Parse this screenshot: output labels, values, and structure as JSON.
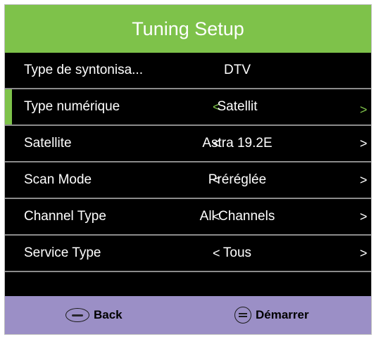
{
  "header": {
    "title": "Tuning Setup"
  },
  "rows": [
    {
      "label": "Type de syntonisa...",
      "value": "DTV",
      "has_arrows": false
    },
    {
      "label": "Type numérique",
      "value": "Satellit",
      "has_arrows": true,
      "left_arrow": "<",
      "right_arrow": ">"
    },
    {
      "label": "Satellite",
      "value": "Astra 19.2E",
      "has_arrows": true,
      "left_arrow": "<",
      "right_arrow": ">"
    },
    {
      "label": "Scan Mode",
      "value": "Préréglée",
      "has_arrows": true,
      "left_arrow": "<",
      "right_arrow": ">"
    },
    {
      "label": "Channel Type",
      "value": "All Channels",
      "has_arrows": true,
      "left_arrow": "<",
      "right_arrow": ">"
    },
    {
      "label": "Service Type",
      "value": "Tous",
      "has_arrows": true,
      "left_arrow": "<",
      "right_arrow": ">"
    }
  ],
  "footer": {
    "back_label": "Back",
    "start_label": "Démarrer",
    "back_icon": "menu-icon",
    "start_icon": "ok-icon"
  },
  "colors": {
    "accent_green": "#7ec24a",
    "footer_bg": "#9b8fc6",
    "panel_bg": "#000000",
    "separator": "#8b8b8b"
  }
}
